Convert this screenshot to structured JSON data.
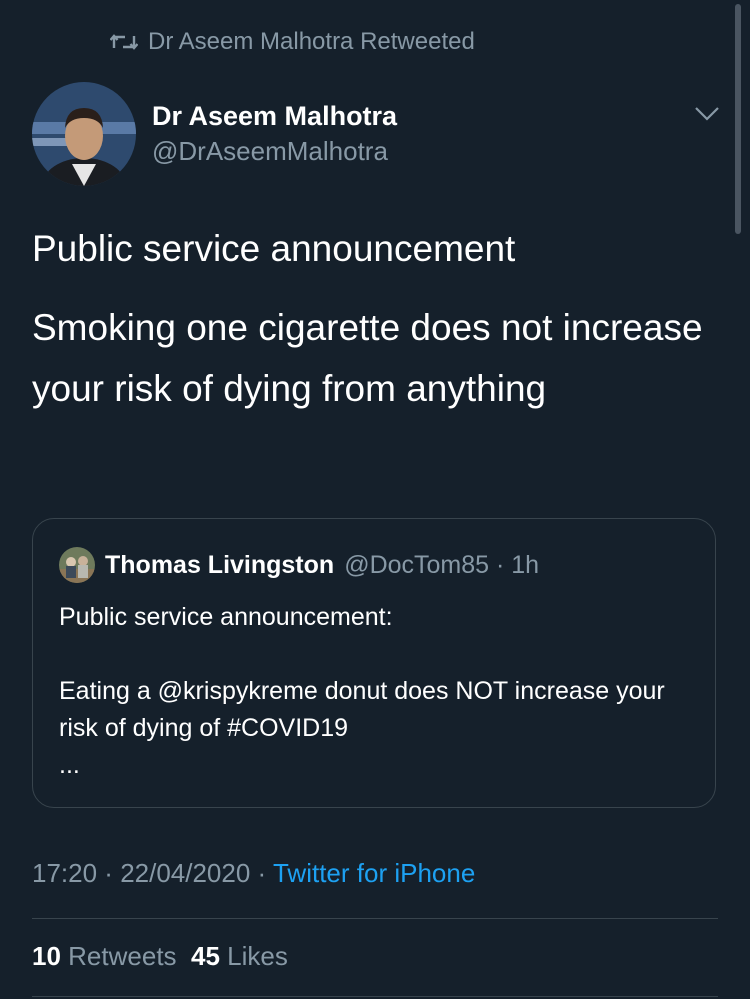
{
  "retweet": {
    "label": "Dr Aseem Malhotra Retweeted",
    "icon": "retweet-icon"
  },
  "author": {
    "name": "Dr Aseem Malhotra",
    "handle": "@DrAseemMalhotra"
  },
  "tweet": {
    "line1": "Public service announcement",
    "line2": "Smoking one cigarette does not increase your risk of dying from anything"
  },
  "quoted": {
    "name": "Thomas Livingston",
    "handle": "@DocTom85",
    "time": "1h",
    "text1": "Public service announcement:",
    "text2": "Eating a @krispykreme donut does NOT increase your risk of dying of #COVID19",
    "ellipsis": "..."
  },
  "meta": {
    "time": "17:20",
    "date": "22/04/2020",
    "source": "Twitter for iPhone"
  },
  "stats": {
    "retweets_count": "10",
    "retweets_label": "Retweets",
    "likes_count": "45",
    "likes_label": "Likes"
  },
  "colors": {
    "background": "#15202b",
    "muted": "#8899a6",
    "accent": "#1da1f2",
    "border": "#38444d"
  }
}
